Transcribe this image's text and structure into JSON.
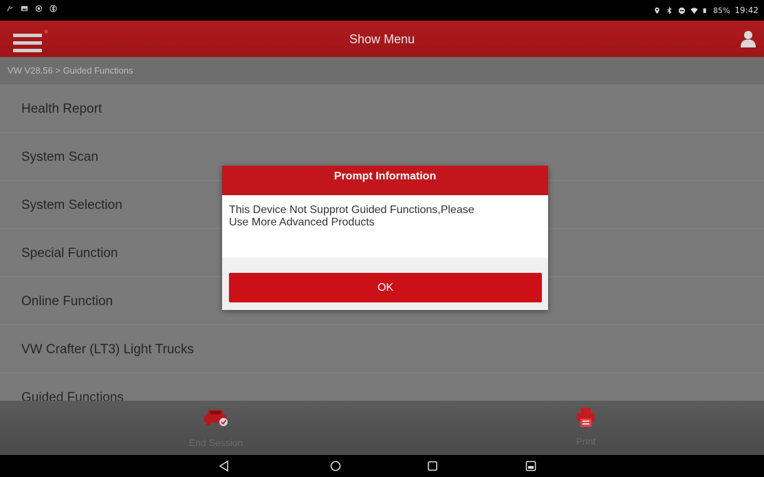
{
  "status_bar": {
    "battery": "85%",
    "time": "19:42"
  },
  "header": {
    "title": "Show Menu"
  },
  "breadcrumb": "VW V28.56 > Guided Functions",
  "menu": {
    "items": [
      {
        "label": "Health Report"
      },
      {
        "label": "System Scan"
      },
      {
        "label": "System Selection"
      },
      {
        "label": "Special Function"
      },
      {
        "label": "Online Function"
      },
      {
        "label": "VW Crafter (LT3) Light Trucks"
      },
      {
        "label": "Guided Functions"
      }
    ]
  },
  "bottom_bar": {
    "end_session_label": "End Session",
    "print_label": "Print"
  },
  "dialog": {
    "title": "Prompt Information",
    "message_line1": "This Device Not Supprot Guided Functions,Please",
    "message_line2": "Use More Advanced Products",
    "ok_label": "OK"
  },
  "colors": {
    "accent": "#c2161c",
    "header": "#a8181b"
  }
}
